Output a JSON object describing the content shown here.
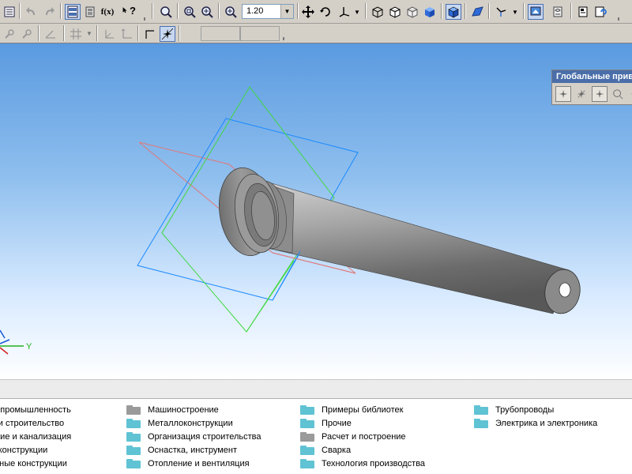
{
  "toolbar": {
    "zoom_value": "1.20",
    "formula_label": "f(x)",
    "help_label": "?"
  },
  "coordinates": {
    "axis_label": "Y X"
  },
  "viewport": {
    "axis_y_label": "Y"
  },
  "global_bindings_panel": {
    "title": "Глобальные привязки"
  },
  "library": {
    "columns": [
      [
        {
          "label": "Космическая промышленность",
          "color": "teal"
        },
        {
          "label": "Архитектура и строительство",
          "color": "teal"
        },
        {
          "label": "Водоснабжение и канализация",
          "color": "teal"
        },
        {
          "label": "Деревянные конструкции",
          "color": "teal"
        },
        {
          "label": "Железобетонные конструкции",
          "color": "teal"
        }
      ],
      [
        {
          "label": "Машиностроение",
          "color": "gray"
        },
        {
          "label": "Металлоконструкции",
          "color": "teal"
        },
        {
          "label": "Организация строительства",
          "color": "teal"
        },
        {
          "label": "Оснастка, инструмент",
          "color": "teal"
        },
        {
          "label": "Отопление и вентиляция",
          "color": "teal"
        }
      ],
      [
        {
          "label": "Примеры библиотек",
          "color": "teal"
        },
        {
          "label": "Прочие",
          "color": "teal"
        },
        {
          "label": "Расчет и построение",
          "color": "gray"
        },
        {
          "label": "Сварка",
          "color": "teal"
        },
        {
          "label": "Технология производства",
          "color": "teal"
        }
      ],
      [
        {
          "label": "Трубопроводы",
          "color": "teal"
        },
        {
          "label": "Электрика и электроника",
          "color": "teal"
        }
      ]
    ]
  }
}
